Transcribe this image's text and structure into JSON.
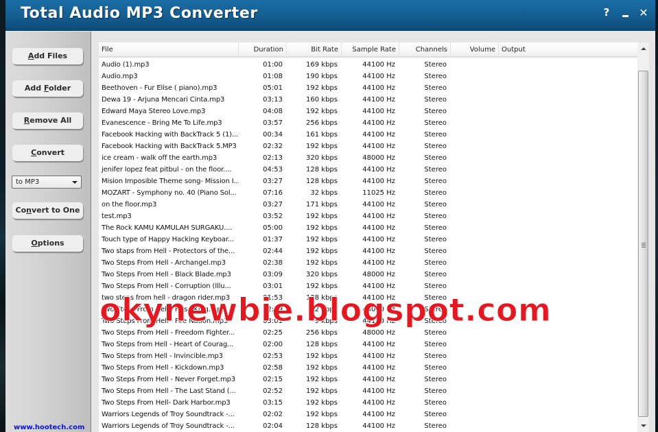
{
  "window": {
    "title": "Total Audio MP3 Converter",
    "help_label": "?",
    "close_label": "✕"
  },
  "sidebar": {
    "add_files": {
      "pre": "",
      "accel": "A",
      "post": "dd Files"
    },
    "add_folder": {
      "pre": "Add ",
      "accel": "F",
      "post": "older"
    },
    "remove_all": {
      "pre": "",
      "accel": "R",
      "post": "emove All"
    },
    "convert": {
      "pre": "",
      "accel": "C",
      "post": "onvert"
    },
    "format_select": {
      "value": "to MP3"
    },
    "convert_to_one": {
      "pre": "Co",
      "accel": "n",
      "post": "vert to One"
    },
    "options": {
      "pre": "",
      "accel": "O",
      "post": "ptions"
    },
    "site_link": "www.hootech.com"
  },
  "list": {
    "columns": {
      "file": "File",
      "duration": "Duration",
      "bit_rate": "Bit Rate",
      "sample_rate": "Sample Rate",
      "channels": "Channels",
      "volume": "Volume",
      "output": "Output"
    },
    "rows": [
      {
        "file": "Audio (1).mp3",
        "duration": "01:00",
        "bit_rate": "169 kbps",
        "sample_rate": "44100 Hz",
        "channels": "Stereo"
      },
      {
        "file": "Audio.mp3",
        "duration": "01:08",
        "bit_rate": "190 kbps",
        "sample_rate": "44100 Hz",
        "channels": "Stereo"
      },
      {
        "file": "Beethoven - Fur Elise ( piano).mp3",
        "duration": "05:01",
        "bit_rate": "192 kbps",
        "sample_rate": "44100 Hz",
        "channels": "Stereo"
      },
      {
        "file": "Dewa 19 - Arjuna Mencari Cinta.mp3",
        "duration": "03:13",
        "bit_rate": "160 kbps",
        "sample_rate": "44100 Hz",
        "channels": "Stereo"
      },
      {
        "file": "Edward Maya   Stereo Love.mp3",
        "duration": "04:08",
        "bit_rate": "192 kbps",
        "sample_rate": "44100 Hz",
        "channels": "Stereo"
      },
      {
        "file": "Evanescence - Bring Me To Life.mp3",
        "duration": "03:57",
        "bit_rate": "256 kbps",
        "sample_rate": "44100 Hz",
        "channels": "Stereo"
      },
      {
        "file": "Facebook Hacking with BackTrack 5 (1)...",
        "duration": "00:34",
        "bit_rate": "161 kbps",
        "sample_rate": "44100 Hz",
        "channels": "Stereo"
      },
      {
        "file": "Facebook Hacking with BackTrack 5.MP3",
        "duration": "02:32",
        "bit_rate": "192 kbps",
        "sample_rate": "44100 Hz",
        "channels": "Stereo"
      },
      {
        "file": "ice cream - walk off the earth.mp3",
        "duration": "02:13",
        "bit_rate": "320 kbps",
        "sample_rate": "48000 Hz",
        "channels": "Stereo"
      },
      {
        "file": "jenifer lopez feat pitbul - on the floor....",
        "duration": "04:53",
        "bit_rate": "128 kbps",
        "sample_rate": "44100 Hz",
        "channels": "Stereo"
      },
      {
        "file": "Mision Imposible Theme song- Mission I...",
        "duration": "03:27",
        "bit_rate": "128 kbps",
        "sample_rate": "44100 Hz",
        "channels": "Stereo"
      },
      {
        "file": "MOZART - Symphony no. 40 (Piano Sol...",
        "duration": "07:16",
        "bit_rate": "32 kbps",
        "sample_rate": "11025 Hz",
        "channels": "Stereo"
      },
      {
        "file": "on the floor.mp3",
        "duration": "03:27",
        "bit_rate": "171 kbps",
        "sample_rate": "44100 Hz",
        "channels": "Stereo"
      },
      {
        "file": "test.mp3",
        "duration": "03:52",
        "bit_rate": "192 kbps",
        "sample_rate": "44100 Hz",
        "channels": "Stereo"
      },
      {
        "file": "The Rock KAMU KAMULAH SURGAKU....",
        "duration": "05:00",
        "bit_rate": "192 kbps",
        "sample_rate": "44100 Hz",
        "channels": "Stereo"
      },
      {
        "file": "Touch type of Happy Hacking Keyboar...",
        "duration": "01:37",
        "bit_rate": "192 kbps",
        "sample_rate": "44100 Hz",
        "channels": "Stereo"
      },
      {
        "file": "Two staps from Hell - Protectors of the...",
        "duration": "02:44",
        "bit_rate": "192 kbps",
        "sample_rate": "44100 Hz",
        "channels": "Stereo"
      },
      {
        "file": "Two Steps From Hell - Archangel.mp3",
        "duration": "02:38",
        "bit_rate": "192 kbps",
        "sample_rate": "44100 Hz",
        "channels": "Stereo"
      },
      {
        "file": "Two Steps From Hell - Black Blade.mp3",
        "duration": "03:09",
        "bit_rate": "320 kbps",
        "sample_rate": "48000 Hz",
        "channels": "Stereo"
      },
      {
        "file": "Two Steps From Hell - Corruption (Illu...",
        "duration": "03:01",
        "bit_rate": "192 kbps",
        "sample_rate": "44100 Hz",
        "channels": "Stereo"
      },
      {
        "file": "two steps from hell - dragon rider.mp3",
        "duration": "01:53",
        "bit_rate": "128 kbps",
        "sample_rate": "44100 Hz",
        "channels": "Stereo"
      },
      {
        "file": "Two Steps From Hell - False King.mp3",
        "duration": "02:19",
        "bit_rate": "32 kbps",
        "sample_rate": "48000 Hz",
        "channels": "Stereo"
      },
      {
        "file": "Two Steps From Hell - Fire Nation.mp3",
        "duration": "03:01",
        "bit_rate": "9 kbps",
        "sample_rate": "44100 Hz",
        "channels": "Stereo"
      },
      {
        "file": "Two Steps From Hell - Freedom Fighter...",
        "duration": "02:25",
        "bit_rate": "256 kbps",
        "sample_rate": "48000 Hz",
        "channels": "Stereo"
      },
      {
        "file": "Two Steps from Hell - Heart of Courag...",
        "duration": "02:00",
        "bit_rate": "128 kbps",
        "sample_rate": "44100 Hz",
        "channels": "Stereo"
      },
      {
        "file": "Two Steps from Hell - Invincible.mp3",
        "duration": "02:53",
        "bit_rate": "192 kbps",
        "sample_rate": "44100 Hz",
        "channels": "Stereo"
      },
      {
        "file": "Two Steps From Hell - Kickdown.mp3",
        "duration": "02:58",
        "bit_rate": "192 kbps",
        "sample_rate": "44100 Hz",
        "channels": "Stereo"
      },
      {
        "file": "Two Steps From Hell - Never Forget.mp3",
        "duration": "02:15",
        "bit_rate": "192 kbps",
        "sample_rate": "44100 Hz",
        "channels": "Stereo"
      },
      {
        "file": "Two Steps From Hell - The Last Stand (...",
        "duration": "02:52",
        "bit_rate": "192 kbps",
        "sample_rate": "44100 Hz",
        "channels": "Stereo"
      },
      {
        "file": "Two Steps From Hell- Dark Harbor.mp3",
        "duration": "03:15",
        "bit_rate": "192 kbps",
        "sample_rate": "44100 Hz",
        "channels": "Stereo"
      },
      {
        "file": "Warriors Legends of Troy Soundtrack -...",
        "duration": "02:02",
        "bit_rate": "192 kbps",
        "sample_rate": "44100 Hz",
        "channels": "Stereo"
      },
      {
        "file": "Warriors Legends of Troy Soundtrack -...",
        "duration": "02:04",
        "bit_rate": "128 kbps",
        "sample_rate": "44100 Hz",
        "channels": "Stereo"
      }
    ]
  },
  "watermark": "okynewbie.blogspot.com",
  "colors": {
    "titlebar": "#145f93",
    "link": "#0a14e6",
    "watermark": "#e8161f"
  }
}
